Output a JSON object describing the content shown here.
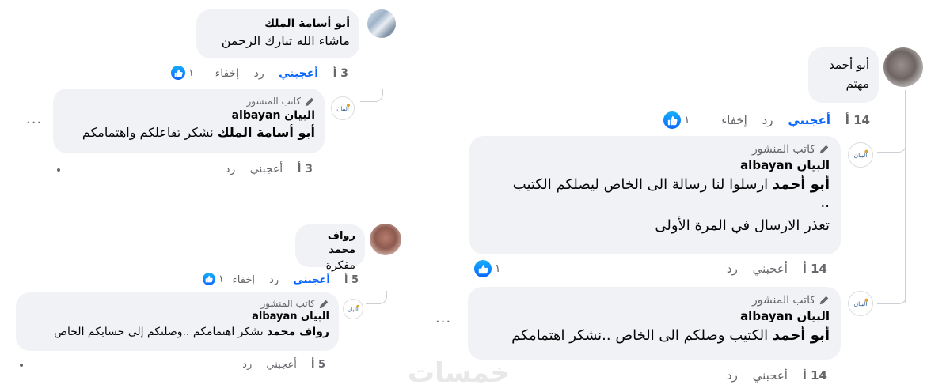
{
  "left_top": {
    "comment": {
      "author": "أبو أسامة الملك",
      "text": "ماشاء الله تبارك الرحمن",
      "time": "3 أ",
      "like": "أعجبني",
      "reply": "رد",
      "hide": "إخفاء",
      "reactions": "١"
    },
    "reply": {
      "badge": "كاتب المنشور",
      "page": "البيان albayan",
      "mention": "أبو أسامة الملك",
      "text": "نشكر تفاعلكم واهتمامكم",
      "time": "3 أ",
      "like": "أعجبني",
      "reply": "رد",
      "more": "..."
    }
  },
  "left_bottom": {
    "comment": {
      "author": "رواف محمد",
      "text": "مفكرة",
      "time": "5 أ",
      "like": "أعجبني",
      "reply": "رد",
      "hide": "إخفاء",
      "reactions": "١"
    },
    "reply": {
      "badge": "كاتب المنشور",
      "page": "البيان albayan",
      "mention": "رواف محمد",
      "text": "نشكر اهتمامكم ..وصلتكم إلى حسابكم الخاص",
      "time": "5 أ",
      "like": "أعجبني",
      "reply": "رد"
    }
  },
  "right": {
    "comment": {
      "author": "أبو أحمد",
      "text": "مهتم",
      "time": "14 أ",
      "like": "أعجبني",
      "reply": "رد",
      "hide": "إخفاء",
      "reactions": "١"
    },
    "reply1": {
      "badge": "كاتب المنشور",
      "page": "البيان albayan",
      "mention": "أبو أحمد",
      "text": "ارسلوا لنا رسالة الى الخاص ليصلكم الكتيب",
      "text2": "..",
      "text3": "تعذر الارسال في المرة الأولى",
      "time": "14 أ",
      "like": "أعجبني",
      "reply": "رد",
      "reactions": "١"
    },
    "reply2": {
      "badge": "كاتب المنشور",
      "page": "البيان albayan",
      "mention": "أبو أحمد",
      "text": "الكتيب وصلكم الى الخاص ..نشكر اهتمامكم",
      "time": "14 أ",
      "like": "أعجبني",
      "reply": "رد",
      "more": "..."
    }
  },
  "watermark": "خمسات",
  "colors": {
    "bubble": "#f0f2f5",
    "link": "#0866ff",
    "meta": "#65676b",
    "text": "#050505"
  }
}
